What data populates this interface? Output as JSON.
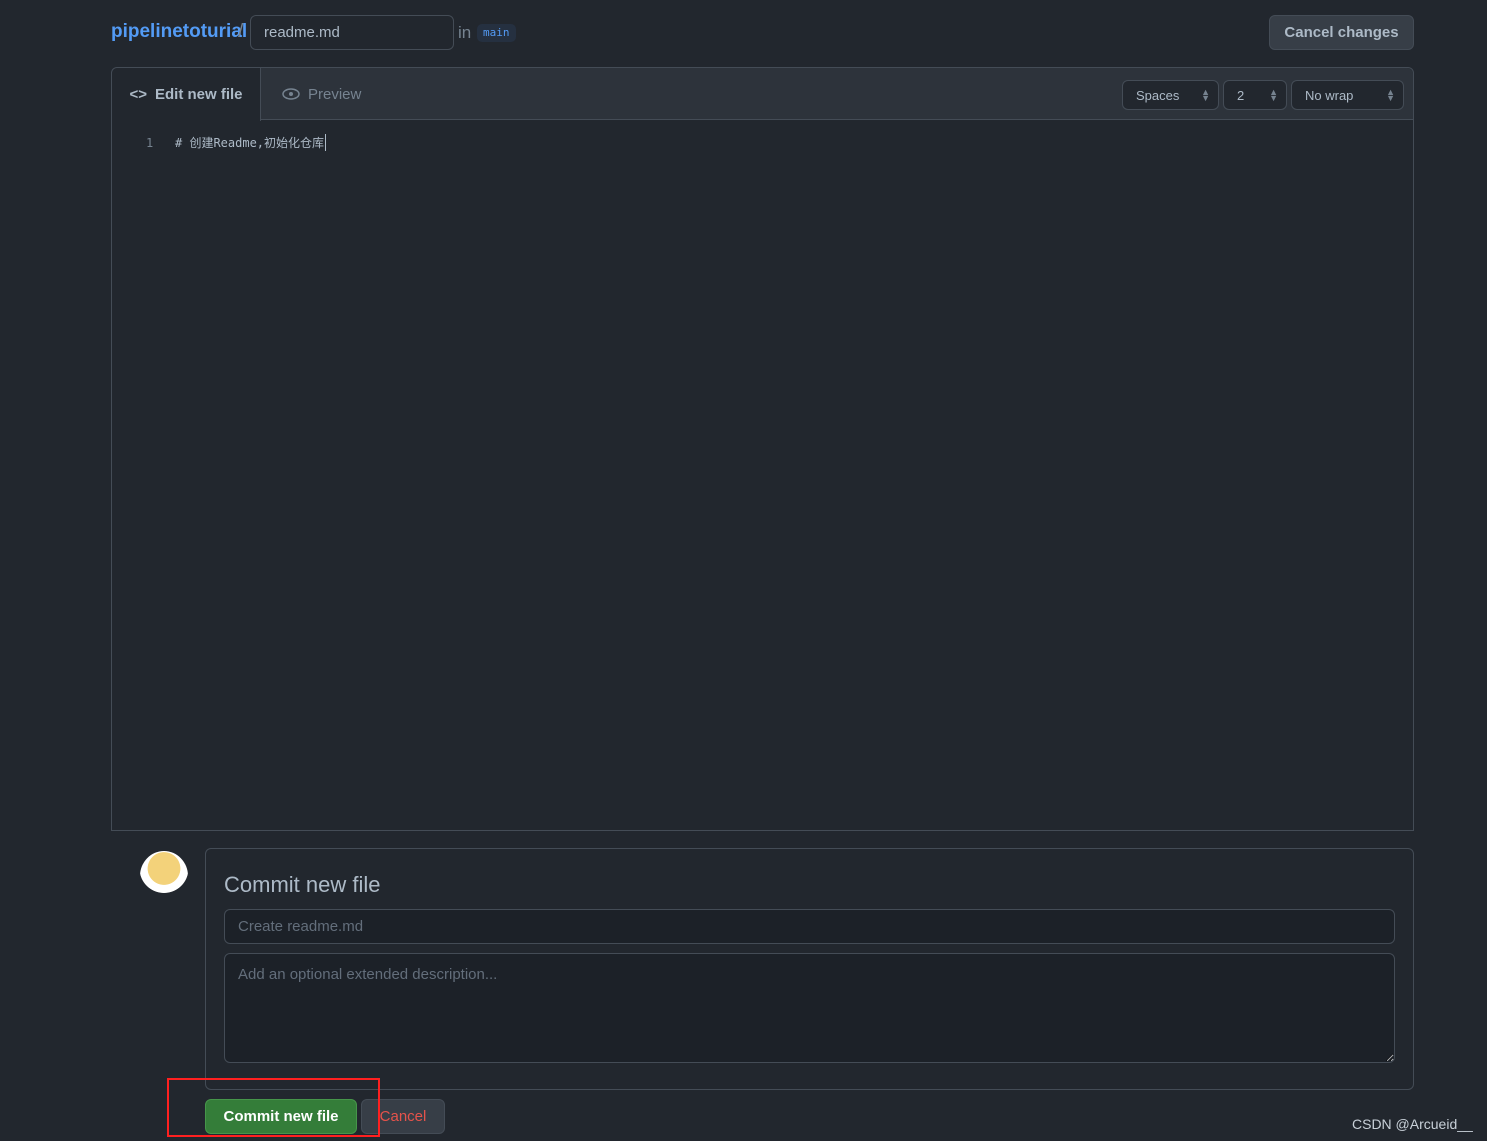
{
  "header": {
    "repo": "pipelinetoturial",
    "separator": "/",
    "filename": "readme.md",
    "in_label": "in",
    "branch": "main",
    "cancel_changes": "Cancel changes"
  },
  "editor": {
    "tabs": [
      {
        "label": "Edit new file",
        "icon": "code-icon",
        "active": true
      },
      {
        "label": "Preview",
        "icon": "eye-icon",
        "active": false
      }
    ],
    "indent_mode": "Spaces",
    "indent_size": "2",
    "wrap_mode": "No wrap",
    "lines": [
      {
        "number": "1",
        "text": "# 创建Readme,初始化仓库"
      }
    ]
  },
  "commit": {
    "title": "Commit new file",
    "summary_placeholder": "Create readme.md",
    "description_placeholder": "Add an optional extended description...",
    "commit_button": "Commit new file",
    "cancel_button": "Cancel"
  },
  "watermark": "CSDN @Arcueid__",
  "colors": {
    "accent": "#539bf5",
    "commit": "#347d39",
    "danger": "#e5534b",
    "highlight": "#ff2020"
  }
}
